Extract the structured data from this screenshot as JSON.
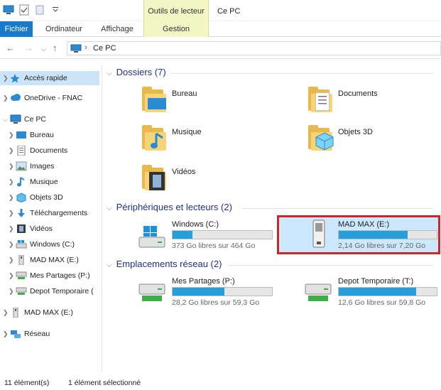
{
  "titlebar": {
    "context_tab": "Outils de lecteur",
    "window_title": "Ce PC",
    "qat_icons": [
      "pc-icon",
      "check-icon",
      "blank-icon",
      "dropdown-icon"
    ]
  },
  "ribbon": {
    "tabs": [
      {
        "label": "Fichier"
      },
      {
        "label": "Ordinateur"
      },
      {
        "label": "Affichage"
      },
      {
        "label": "Gestion"
      }
    ]
  },
  "address": {
    "path": "Ce PC"
  },
  "nav": {
    "items": [
      {
        "label": "Accès rapide",
        "icon": "star-icon"
      },
      {
        "label": "OneDrive - FNAC",
        "icon": "cloud-icon"
      },
      {
        "label": "Ce PC",
        "icon": "pc-icon"
      },
      {
        "label": "Bureau",
        "icon": "desktop-folder-icon"
      },
      {
        "label": "Documents",
        "icon": "documents-icon"
      },
      {
        "label": "Images",
        "icon": "images-icon"
      },
      {
        "label": "Musique",
        "icon": "music-icon"
      },
      {
        "label": "Objets 3D",
        "icon": "cube-icon"
      },
      {
        "label": "Téléchargements",
        "icon": "download-icon"
      },
      {
        "label": "Vidéos",
        "icon": "film-icon"
      },
      {
        "label": "Windows (C:)",
        "icon": "system-drive-icon"
      },
      {
        "label": "MAD MAX (E:)",
        "icon": "usb-drive-icon"
      },
      {
        "label": "Mes Partages (P:)",
        "icon": "network-drive-icon"
      },
      {
        "label": "Depot Temporaire (",
        "icon": "network-drive-icon"
      },
      {
        "label": "MAD MAX (E:)",
        "icon": "usb-drive-icon"
      },
      {
        "label": "Réseau",
        "icon": "network-icon"
      }
    ]
  },
  "content": {
    "sections": [
      {
        "title": "Dossiers (7)"
      },
      {
        "title": "Périphériques et lecteurs (2)"
      },
      {
        "title": "Emplacements réseau (2)"
      }
    ],
    "folders": [
      {
        "label": "Bureau",
        "icon": "desktop-folder-icon"
      },
      {
        "label": "Documents",
        "icon": "documents-folder-icon"
      },
      {
        "label": "Musique",
        "icon": "music-folder-icon"
      },
      {
        "label": "Objets 3D",
        "icon": "objects3d-folder-icon"
      },
      {
        "label": "Vidéos",
        "icon": "videos-folder-icon"
      }
    ],
    "drives": [
      {
        "label": "Windows (C:)",
        "info": "373 Go libres sur 464 Go",
        "used_fraction": 0.2,
        "icon": "system-drive-icon"
      },
      {
        "label": "MAD MAX (E:)",
        "info": "2,14 Go libres sur 7,20 Go",
        "used_fraction": 0.7,
        "icon": "usb-drive-icon"
      }
    ],
    "network": [
      {
        "label": "Mes Partages (P:)",
        "info": "28,2 Go libres sur 59,3 Go",
        "used_fraction": 0.52,
        "icon": "network-drive-icon"
      },
      {
        "label": "Depot Temporaire (T:)",
        "info": "12,6 Go libres sur 59,8 Go",
        "used_fraction": 0.79,
        "icon": "network-drive-icon"
      }
    ]
  },
  "status": {
    "count": "11 élément(s)",
    "selected": "1 élément sélectionné"
  },
  "colors": {
    "accent": "#1979ca",
    "bar_fill": "#26a0da",
    "selection": "#cce8ff",
    "highlight_border": "#d3222a",
    "context_tab": "#f3f7c5"
  }
}
